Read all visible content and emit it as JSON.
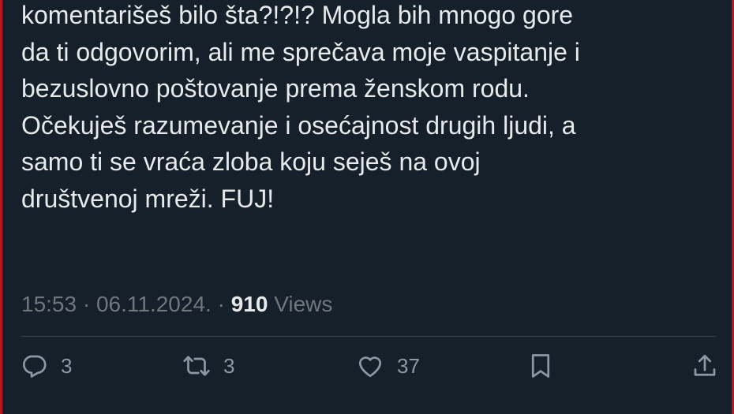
{
  "tweet": {
    "lines": [
      "komentarišeš bilo šta?!?!? Mogla bih mnogo gore",
      "da ti odgovorim, ali me sprečava moje vaspitanje i",
      "bezuslovno poštovanje prema ženskom rodu.",
      "Očekuješ razumevanje i osećajnost drugih ljudi, a",
      "samo ti se vraća zloba koju seješ na ovoj",
      "društvenoj mreži. FUJ!"
    ]
  },
  "meta": {
    "time": "15:53",
    "separator_1": " · ",
    "date": "06.11.2024.",
    "separator_2": " · ",
    "views_count": "910",
    "views_label": " Views"
  },
  "actions": {
    "reply": {
      "icon": "reply-icon",
      "count": "3"
    },
    "retweet": {
      "icon": "retweet-icon",
      "count": "3"
    },
    "like": {
      "icon": "heart-icon",
      "count": "37"
    },
    "bookmark": {
      "icon": "bookmark-icon"
    },
    "share": {
      "icon": "share-icon"
    }
  },
  "colors": {
    "background": "#15202b",
    "text": "#e7e9ea",
    "secondary_text": "#71767b",
    "icon": "#8b98a5",
    "frame_border": "#c1121f"
  }
}
